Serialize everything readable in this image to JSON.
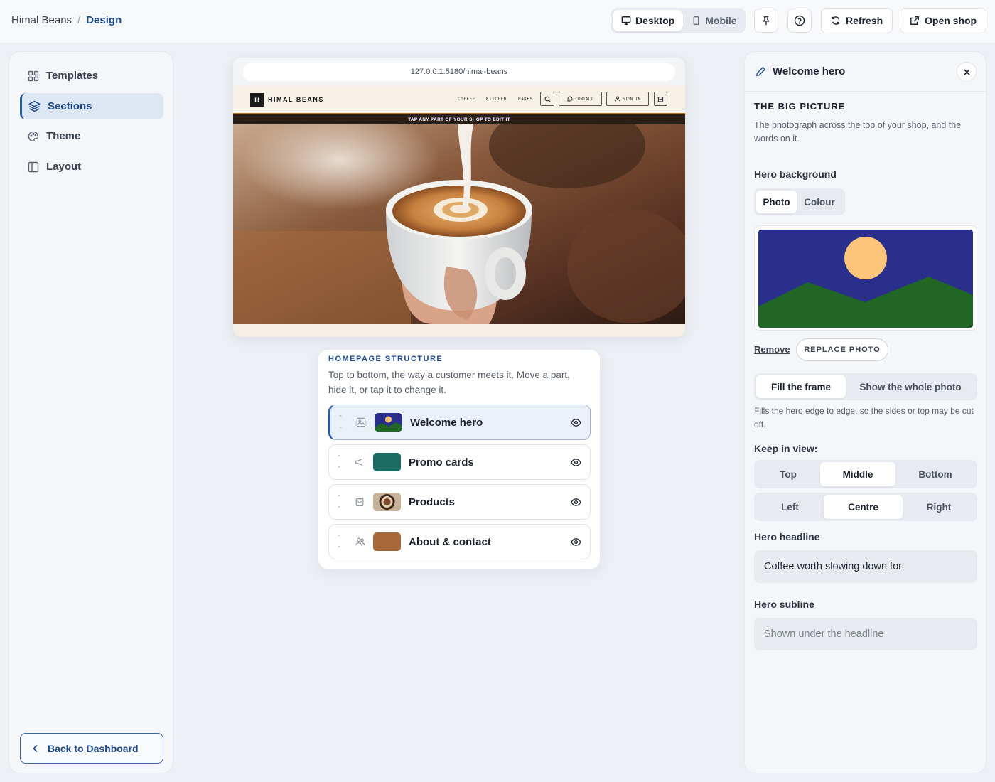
{
  "breadcrumb": {
    "root": "Himal Beans",
    "separator": "/",
    "current": "Design"
  },
  "toolbar": {
    "device_desktop": "Desktop",
    "device_mobile": "Mobile",
    "refresh": "Refresh",
    "open_shop": "Open shop"
  },
  "sidebar": {
    "items": [
      {
        "label": "Templates",
        "icon": "grid-icon"
      },
      {
        "label": "Sections",
        "icon": "layers-icon"
      },
      {
        "label": "Theme",
        "icon": "palette-icon"
      },
      {
        "label": "Layout",
        "icon": "layout-icon"
      }
    ],
    "back": "Back to Dashboard"
  },
  "preview": {
    "url": "127.0.0.1:5180/himal-beans",
    "logo_letter": "H",
    "shop_name": "HIMAL BEANS",
    "links": [
      "COFFEE",
      "KITCHEN",
      "BAKES"
    ],
    "contact": "CONTACT",
    "sign_in": "SIGN IN",
    "edit_hint": "TAP ANY PART OF YOUR SHOP TO EDIT IT"
  },
  "structure": {
    "title": "HOMEPAGE STRUCTURE",
    "description": "Top to bottom, the way a customer meets it. Move a part, hide it, or tap it to change it.",
    "sections": [
      {
        "label": "Welcome hero",
        "type_icon": "image-icon"
      },
      {
        "label": "Promo cards",
        "type_icon": "megaphone-icon"
      },
      {
        "label": "Products",
        "type_icon": "bag-icon"
      },
      {
        "label": "About & contact",
        "type_icon": "people-icon"
      }
    ]
  },
  "panel": {
    "title": "Welcome hero",
    "heading": "THE BIG PICTURE",
    "description": "The photograph across the top of your shop, and the words on it.",
    "background_label": "Hero background",
    "background_options": [
      "Photo",
      "Colour"
    ],
    "remove": "Remove",
    "replace": "REPLACE PHOTO",
    "fit_options": [
      "Fill the frame",
      "Show the whole photo"
    ],
    "fit_note": "Fills the hero edge to edge, so the sides or top may be cut off.",
    "keep_label": "Keep in view:",
    "vertical_options": [
      "Top",
      "Middle",
      "Bottom"
    ],
    "horizontal_options": [
      "Left",
      "Centre",
      "Right"
    ],
    "headline_label": "Hero headline",
    "headline_value": "Coffee worth slowing down for",
    "subline_label": "Hero subline",
    "subline_placeholder": "Shown under the headline"
  },
  "colors": {
    "accent": "#1e4a8a",
    "hero_sky": "#2a2f8c",
    "hero_sun": "#fcc57a",
    "hero_hill": "#216625",
    "promo_thumb": "#1c6b62",
    "about_thumb": "#a8693a"
  }
}
